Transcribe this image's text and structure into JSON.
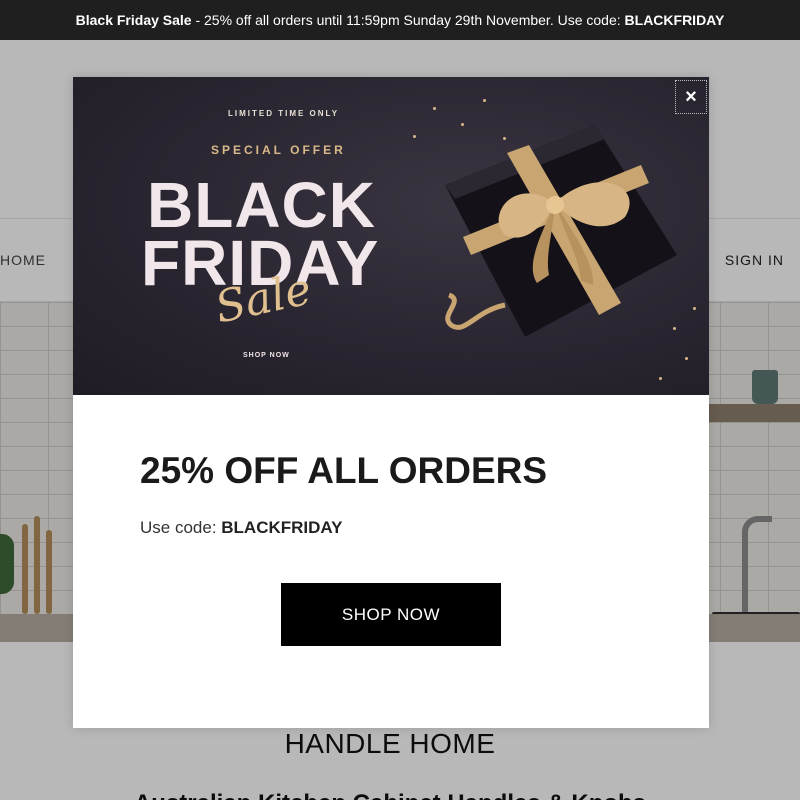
{
  "announcement": {
    "bold_lead": "Black Friday Sale",
    "text": " - 25% off all orders until 11:59pm Sunday 29th November. Use code: ",
    "code": "BLACKFRIDAY"
  },
  "nav": {
    "home_label": "HOME",
    "signin_label": "SIGN IN"
  },
  "page": {
    "brand_title": "HANDLE HOME",
    "brand_subtitle": "Australian Kitchen Cabinet Handles & Knobs"
  },
  "modal": {
    "close_label": "×",
    "image": {
      "limited": "LIMITED TIME ONLY",
      "special": "SPECIAL OFFER",
      "line1": "BLACK",
      "line2": "FRIDAY",
      "script": "Sale",
      "shop_now": "SHOP NOW"
    },
    "heading": "25% OFF ALL ORDERS",
    "code_prefix": "Use code: ",
    "code": "BLACKFRIDAY",
    "cta_label": "SHOP NOW"
  },
  "colors": {
    "announcement_bg": "#1f1f1f",
    "cta_bg": "#000000",
    "gold_accent": "#d9b98a",
    "banner_bg": "#2a2631"
  },
  "icons": {
    "close": "close-icon",
    "gift": "gift-box-icon"
  }
}
